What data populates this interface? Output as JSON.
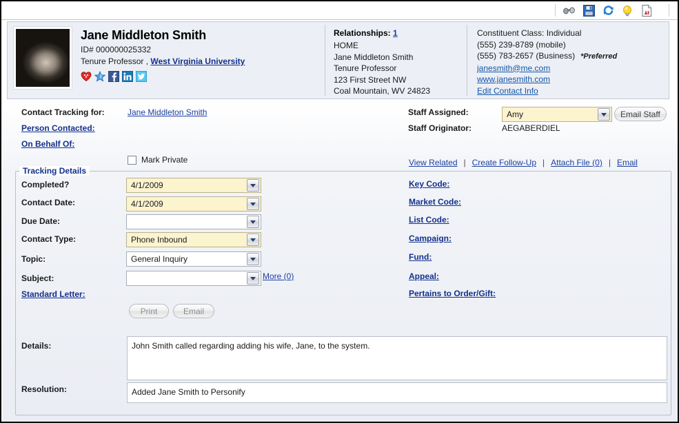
{
  "toolbar": {
    "icons": [
      {
        "name": "binoculars-icon",
        "glyph": "binoculars"
      },
      {
        "name": "save-icon",
        "glyph": "floppy"
      },
      {
        "name": "refresh-icon",
        "glyph": "refresh"
      },
      {
        "name": "lightbulb-icon",
        "glyph": "bulb"
      },
      {
        "name": "report-icon",
        "glyph": "report"
      }
    ]
  },
  "header": {
    "person_name": "Jane Middleton Smith",
    "person_id": "ID# 000000025332",
    "title_text": "Tenure Professor ,",
    "organization": "West Virginia University",
    "social": [
      "favorite-heart-icon",
      "star-icon",
      "facebook-icon",
      "linkedin-icon",
      "twitter-icon"
    ],
    "relationships_label": "Relationships:",
    "relationships_count": "1",
    "relationship_lines": [
      "HOME",
      "Jane Middleton Smith",
      "Tenure Professor",
      "123 First Street NW",
      "Coal Mountain, WV 24823"
    ],
    "constituent_class": "Constituent Class: Individual",
    "phone_mobile": "(555) 239-8789 (mobile)",
    "phone_business": "(555) 783-2657 (Business)",
    "preferred_marker": "*Preferred",
    "email": "janesmith@me.com",
    "website": "www.janesmith.com",
    "edit_contact_info": "Edit Contact Info"
  },
  "form": {
    "contact_tracking_for_label": "Contact Tracking for:",
    "contact_tracking_for_value": "Jane Middleton Smith",
    "person_contacted_label": "Person Contacted:",
    "on_behalf_of_label": "On Behalf Of:",
    "mark_private_label": "Mark Private",
    "mark_private_checked": false,
    "staff_assigned_label": "Staff Assigned:",
    "staff_assigned_value": "Amy",
    "staff_originator_label": "Staff Originator:",
    "staff_originator_value": "AEGABERDIEL",
    "email_staff_button": "Email Staff",
    "action_links": [
      "View Related",
      "Create Follow-Up",
      "Attach File (0)",
      "Email"
    ],
    "action_separator": "|"
  },
  "tracking": {
    "legend": "Tracking Details",
    "rows": [
      {
        "label": "Completed?",
        "value": "4/1/2009",
        "filled": true,
        "checkbox": true
      },
      {
        "label": "Contact Date:",
        "value": "4/1/2009",
        "filled": true,
        "checkbox": false
      },
      {
        "label": "Due Date:",
        "value": "",
        "filled": false,
        "checkbox": false
      },
      {
        "label": "Contact Type:",
        "value": "Phone Inbound",
        "filled": true,
        "checkbox": false
      },
      {
        "label": "Topic:",
        "value": "General Inquiry",
        "filled": false,
        "checkbox": false
      },
      {
        "label": "Subject:",
        "value": "",
        "filled": false,
        "checkbox": false
      }
    ],
    "more_link": "More (0)",
    "standard_letter_label": "Standard Letter:",
    "print_button": "Print",
    "email_button": "Email",
    "right_links": [
      "Key Code:",
      "Market Code:",
      "List Code:",
      "Campaign:",
      "Fund:",
      "Appeal:",
      "Pertains to Order/Gift:"
    ],
    "details_label": "Details:",
    "details_value": "John Smith called regarding adding his wife, Jane, to the system.",
    "resolution_label": "Resolution:",
    "resolution_value": "Added Jane Smith to Personify"
  },
  "colors": {
    "link": "#1b3fa0",
    "field_highlight": "#fcf3cf",
    "header_bg": "#eceff5"
  }
}
